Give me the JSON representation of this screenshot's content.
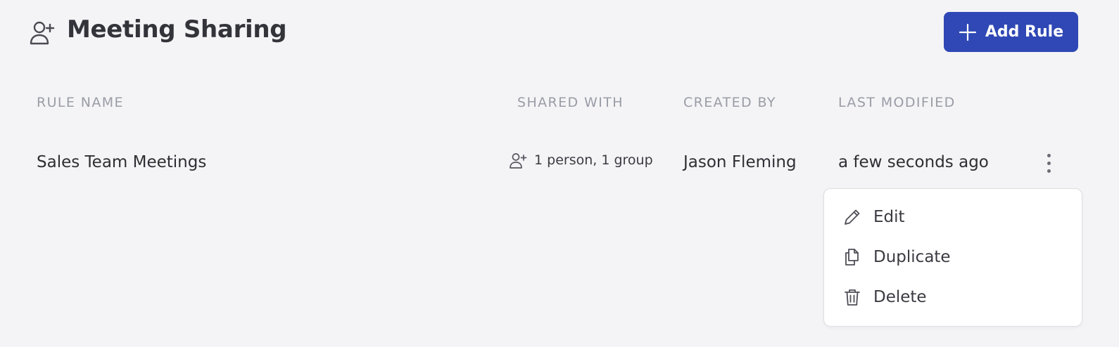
{
  "header": {
    "title": "Meeting Sharing",
    "title_icon": "user-plus-icon",
    "add_button_label": "Add Rule",
    "add_button_icon": "plus-icon"
  },
  "table": {
    "columns": [
      "RULE NAME",
      "SHARED WITH",
      "CREATED BY",
      "LAST MODIFIED"
    ],
    "rows": [
      {
        "rule_name": "Sales Team Meetings",
        "shared_with": "1 person, 1 group",
        "created_by": "Jason Fleming",
        "last_modified": "a few seconds ago"
      }
    ]
  },
  "menu": {
    "items": [
      {
        "label": "Edit",
        "icon": "pencil-icon"
      },
      {
        "label": "Duplicate",
        "icon": "copy-icon"
      },
      {
        "label": "Delete",
        "icon": "trash-icon"
      }
    ]
  },
  "colors": {
    "accent": "#2f48b5",
    "background": "#f4f4f6",
    "header_text": "#9a9ca6"
  }
}
